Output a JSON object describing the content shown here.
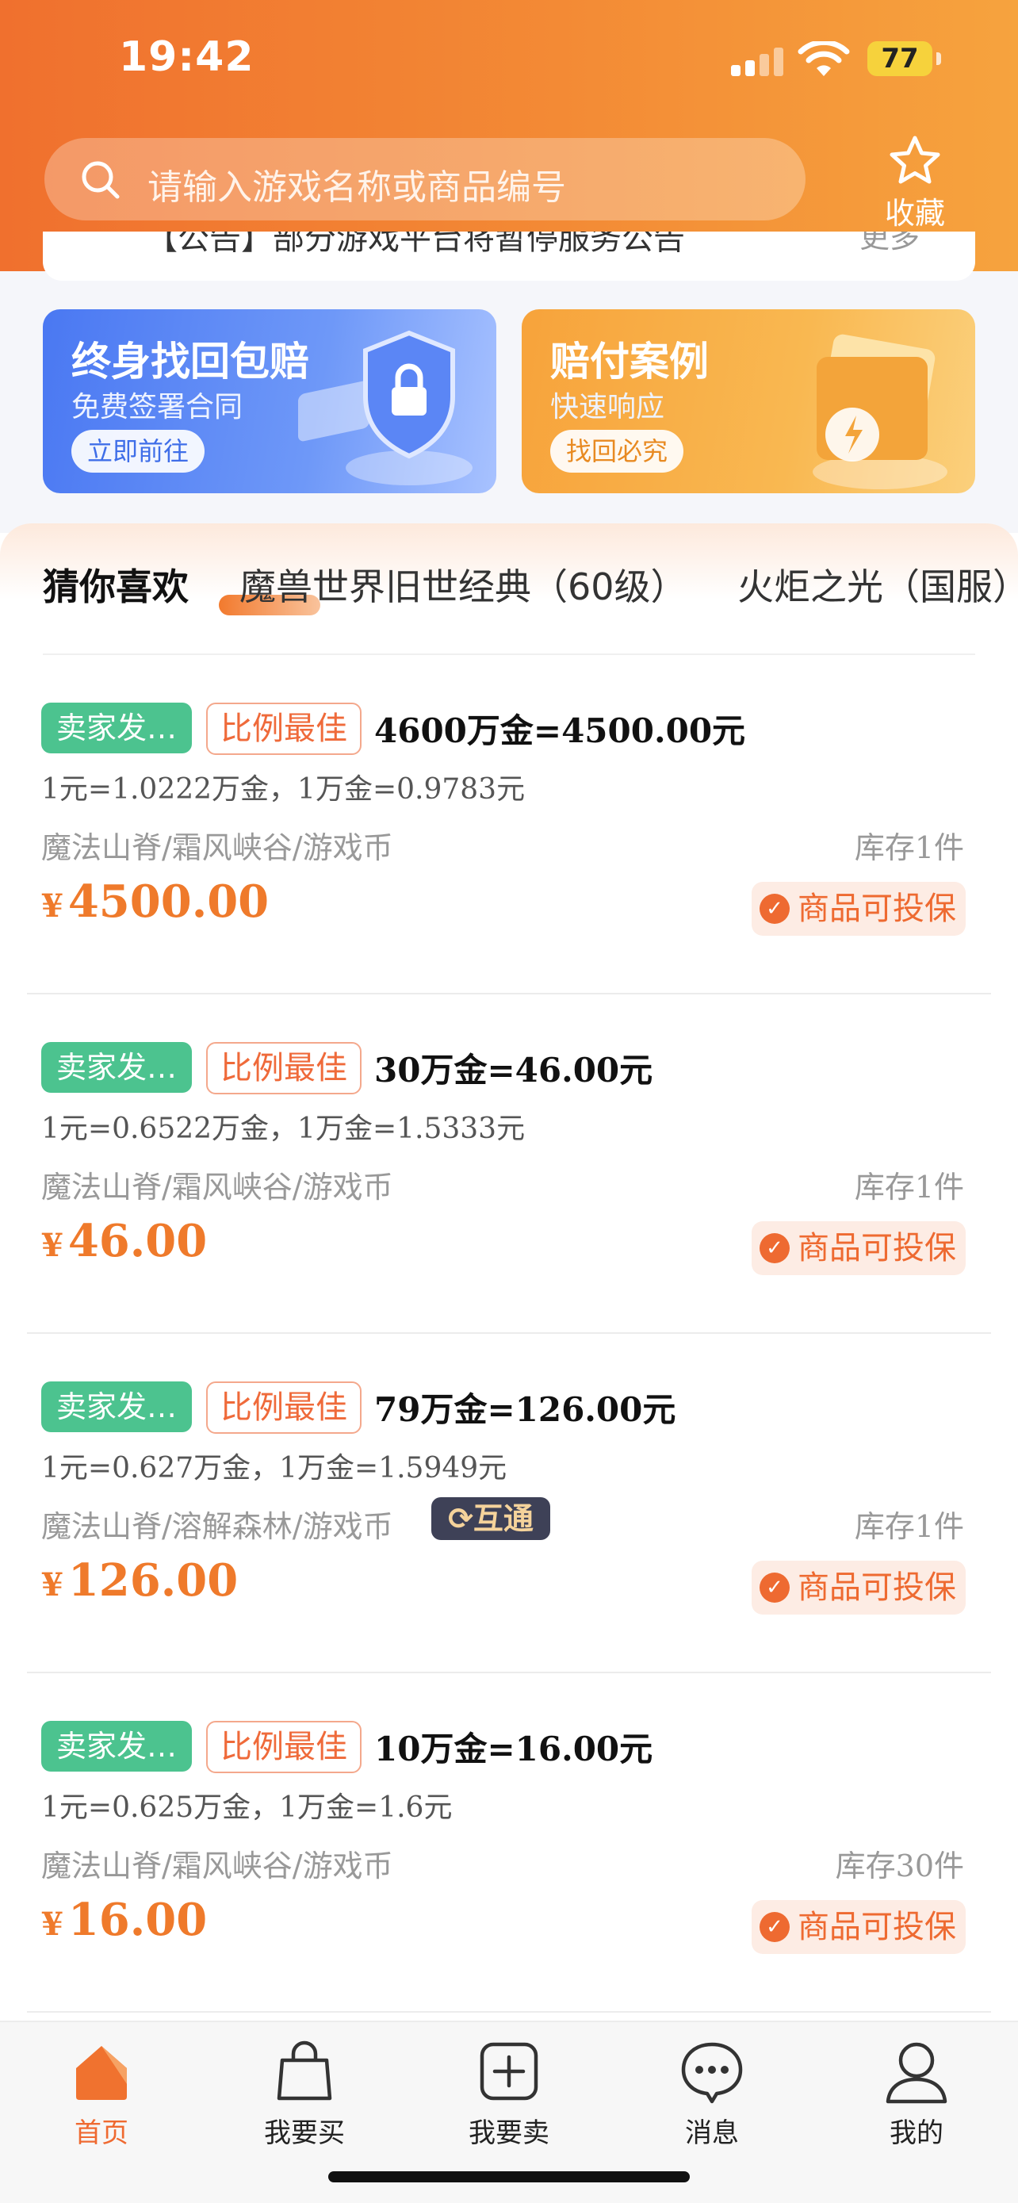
{
  "status": {
    "time": "19:42",
    "battery": "77"
  },
  "header": {
    "search_placeholder": "请输入游戏名称或商品编号",
    "favorite_label": "收藏",
    "notice_text": "【公告】部分游戏平台将暂停服务公告",
    "notice_more": "更多"
  },
  "banners": [
    {
      "title": "终身找回包赔",
      "subtitle": "免费签署合同",
      "button": "立即前往"
    },
    {
      "title": "赔付案例",
      "subtitle": "快速响应",
      "button": "找回必究"
    }
  ],
  "tabs": [
    "猜你喜欢",
    "魔兽世界旧世经典（60级）",
    "火炬之光（国服）"
  ],
  "listings": [
    {
      "seller_badge": "卖家发…",
      "best_badge": "比例最佳",
      "title": "4600万金=4500.00元",
      "rate": "1元=1.0222万金，1万金=0.9783元",
      "path": "魔法山脊/霜风峡谷/游戏币",
      "stock": "库存1件",
      "price_symbol": "¥",
      "price": "4500.00",
      "insure": "商品可投保"
    },
    {
      "seller_badge": "卖家发…",
      "best_badge": "比例最佳",
      "title": "30万金=46.00元",
      "rate": "1元=0.6522万金，1万金=1.5333元",
      "path": "魔法山脊/霜风峡谷/游戏币",
      "stock": "库存1件",
      "price_symbol": "¥",
      "price": "46.00",
      "insure": "商品可投保"
    },
    {
      "seller_badge": "卖家发…",
      "best_badge": "比例最佳",
      "title": "79万金=126.00元",
      "rate": "1元=0.627万金，1万金=1.5949元",
      "path": "魔法山脊/溶解森林/游戏币",
      "interop": "互通",
      "stock": "库存1件",
      "price_symbol": "¥",
      "price": "126.00",
      "insure": "商品可投保"
    },
    {
      "seller_badge": "卖家发…",
      "best_badge": "比例最佳",
      "title": "10万金=16.00元",
      "rate": "1元=0.625万金，1万金=1.6元",
      "path": "魔法山脊/霜风峡谷/游戏币",
      "stock": "库存30件",
      "price_symbol": "¥",
      "price": "16.00",
      "insure": "商品可投保"
    }
  ],
  "nav": [
    {
      "label": "首页",
      "icon": "home-icon",
      "active": true
    },
    {
      "label": "我要买",
      "icon": "shopping-bag-icon",
      "active": false
    },
    {
      "label": "我要卖",
      "icon": "plus-square-icon",
      "active": false
    },
    {
      "label": "消息",
      "icon": "chat-bubble-icon",
      "active": false
    },
    {
      "label": "我的",
      "icon": "user-icon",
      "active": false
    }
  ],
  "colors": {
    "brand_orange": "#ef7a2b",
    "seller_green": "#4cc38f",
    "best_red": "#ef6a3a"
  }
}
